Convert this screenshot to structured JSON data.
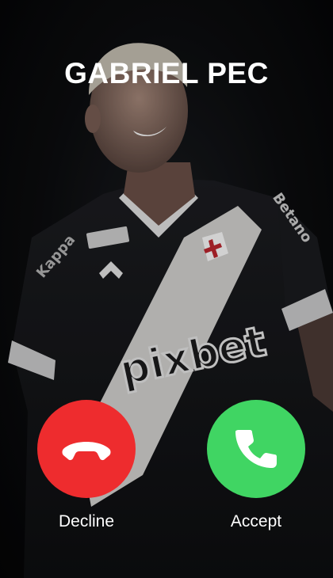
{
  "caller": {
    "name": "GABRIEL PEC",
    "photo": {
      "description_icon": "player-photo",
      "jersey_text": "pixbet",
      "sleeve_text": "Betano",
      "brand_text": "Kappa"
    }
  },
  "actions": {
    "decline": {
      "label": "Decline",
      "icon": "phone-hangup-icon",
      "color": "#EE2C2E"
    },
    "accept": {
      "label": "Accept",
      "icon": "phone-icon",
      "color": "#40D563"
    }
  }
}
